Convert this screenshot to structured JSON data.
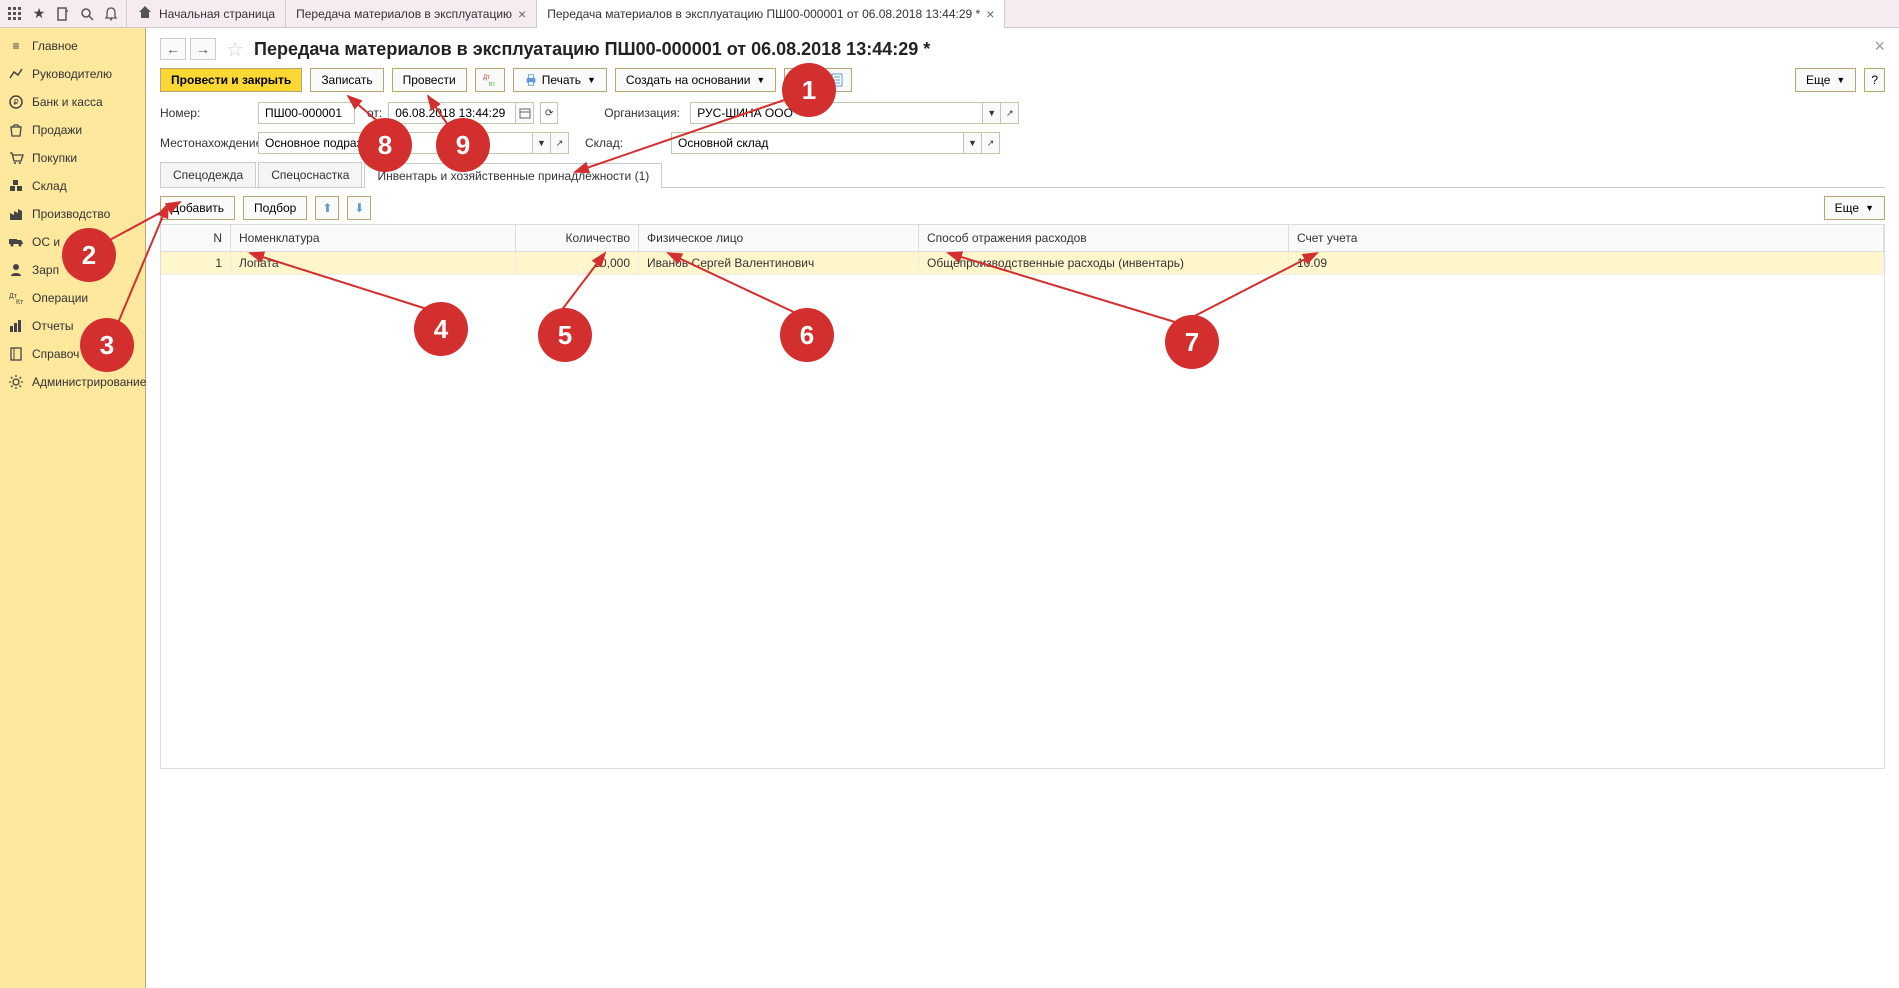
{
  "tabs": {
    "home": "Начальная страница",
    "tab1": "Передача материалов в эксплуатацию",
    "tab2": "Передача материалов в эксплуатацию ПШ00-000001 от 06.08.2018 13:44:29 *"
  },
  "sidebar": [
    "Главное",
    "Руководителю",
    "Банк и касса",
    "Продажи",
    "Покупки",
    "Склад",
    "Производство",
    "ОС и НМА",
    "Зарплата и кадры",
    "Операции",
    "Отчеты",
    "Справочники",
    "Администрирование"
  ],
  "sidebar_trunc": [
    "ОС и",
    "Зарп",
    "Справоч"
  ],
  "doc": {
    "title": "Передача материалов в эксплуатацию ПШ00-000001 от 06.08.2018 13:44:29 *"
  },
  "toolbar": {
    "post_close": "Провести и закрыть",
    "save": "Записать",
    "post": "Провести",
    "print": "Печать",
    "create_based": "Создать на основании",
    "more": "Еще"
  },
  "form": {
    "number_label": "Номер:",
    "number_value": "ПШ00-000001",
    "date_label": "от:",
    "date_value": "06.08.2018 13:44:29",
    "org_label": "Организация:",
    "org_value": "РУС-ШИНА ООО",
    "location_label": "Местонахождение:",
    "location_value": "Основное подразделение",
    "warehouse_label": "Склад:",
    "warehouse_value": "Основной склад"
  },
  "subtabs": {
    "tab1": "Спецодежда",
    "tab2": "Спецоснастка",
    "tab3": "Инвентарь и хозяйственные принадлежности (1)"
  },
  "table_toolbar": {
    "add": "Добавить",
    "select": "Подбор",
    "more": "Еще"
  },
  "grid": {
    "headers": {
      "n": "N",
      "nomenclature": "Номенклатура",
      "quantity": "Количество",
      "person": "Физическое лицо",
      "expense": "Способ отражения расходов",
      "account": "Счет учета"
    },
    "rows": [
      {
        "n": "1",
        "nomenclature": "Лопата",
        "quantity": "10,000",
        "person": "Иванов Сергей Валентинович",
        "expense": "Общепроизводственные расходы (инвентарь)",
        "account": "10.09"
      }
    ]
  },
  "annotations": [
    "1",
    "2",
    "3",
    "4",
    "5",
    "6",
    "7",
    "8",
    "9"
  ]
}
